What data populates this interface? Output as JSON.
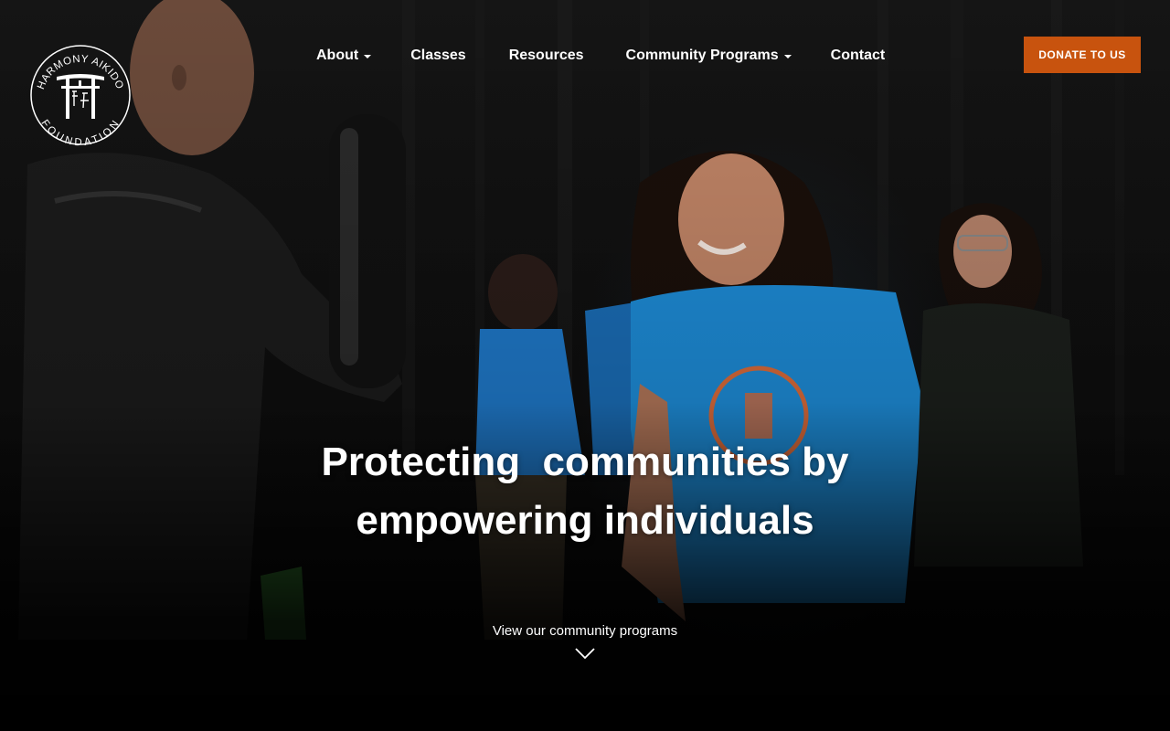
{
  "brand": {
    "logo_text_top": "HARMONY AIKIDO",
    "logo_text_bottom": "FOUNDATION",
    "logo_icon": "torii-gate-icon"
  },
  "nav": {
    "items": [
      {
        "label": "About",
        "has_dropdown": true
      },
      {
        "label": "Classes",
        "has_dropdown": false
      },
      {
        "label": "Resources",
        "has_dropdown": false
      },
      {
        "label": "Community Programs",
        "has_dropdown": true
      },
      {
        "label": "Contact",
        "has_dropdown": false
      }
    ]
  },
  "donate": {
    "label": "DONATE TO US",
    "color": "#c8530e"
  },
  "hero": {
    "headline_line1": "Protecting  communities by",
    "headline_line2": "empowering individuals",
    "cta_label": "View our community programs",
    "cta_icon": "chevron-down-icon"
  }
}
